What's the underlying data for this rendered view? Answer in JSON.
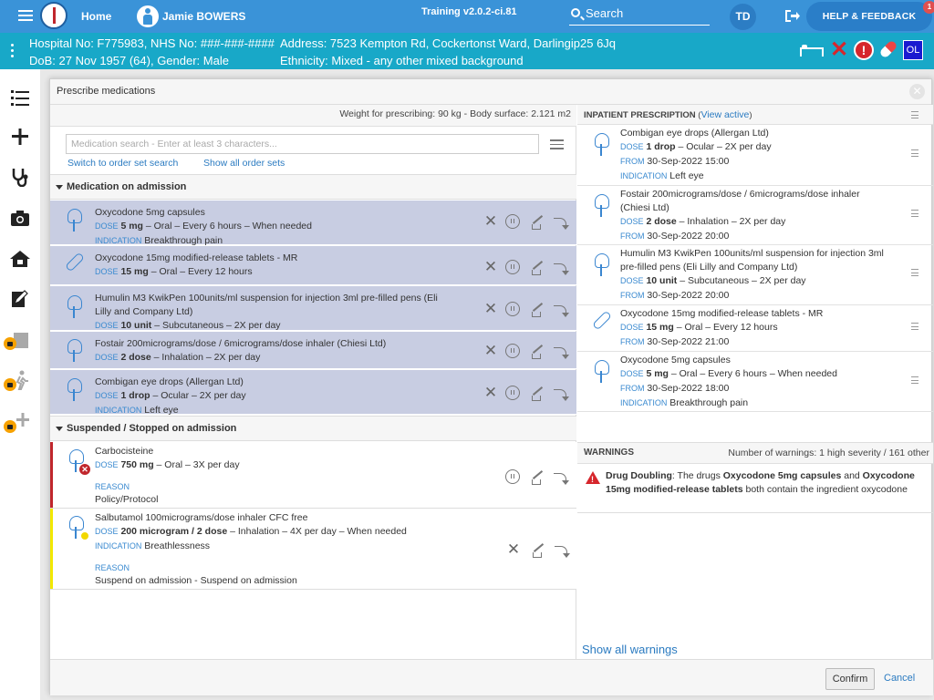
{
  "topbar": {
    "home_label": "Home",
    "patient_name": "Jamie BOWERS",
    "version": "Training v2.0.2-ci.81",
    "search_label": "Search",
    "avatar_initials": "TD",
    "help_label": "HELP & FEEDBACK",
    "help_badge": "1"
  },
  "patient": {
    "line1_left": "Hospital No: F775983, NHS No: ###-###-####",
    "line1_right": "Address: 7523 Kempton Rd, Cockertonst Ward, Darlingip25 6Jq",
    "line2_left": "DoB: 27 Nov 1957 (64), Gender: Male",
    "line2_right": "Ethnicity: Mixed - any other mixed background",
    "ol_label": "OL"
  },
  "modal": {
    "title": "Prescribe medications",
    "weight_line": "Weight for prescribing: 90 kg - Body surface: 2.121 m2",
    "search_placeholder": "Medication search - Enter at least 3 characters...",
    "link_order_set": "Switch to order set search",
    "link_show_all": "Show all order sets",
    "section_admission": "Medication on admission",
    "section_suspended": "Suspended / Stopped on admission",
    "labels": {
      "dose": "DOSE",
      "indication": "INDICATION",
      "reason": "REASON",
      "from": "FROM"
    },
    "admission_meds": [
      {
        "name": "Oxycodone 5mg capsules",
        "dose_bold": "5 mg",
        "dose_rest": " – Oral – Every 6 hours – When needed",
        "indication": "Breakthrough pain"
      },
      {
        "name": "Oxycodone 15mg modified-release tablets - MR",
        "dose_bold": "15 mg",
        "dose_rest": " – Oral – Every 12 hours"
      },
      {
        "name_l1": "Humulin M3 KwikPen 100units/ml suspension for injection 3ml pre-filled pens (Eli",
        "name_l2": "Lilly and Company Ltd)",
        "dose_bold": "10 unit",
        "dose_rest": " – Subcutaneous – 2X per day"
      },
      {
        "name": "Fostair 200micrograms/dose / 6micrograms/dose inhaler (Chiesi Ltd)",
        "dose_bold": "2 dose",
        "dose_rest": " – Inhalation – 2X per day"
      },
      {
        "name": "Combigan eye drops (Allergan Ltd)",
        "dose_bold": "1 drop",
        "dose_rest": " – Ocular – 2X per day",
        "indication": "Left eye"
      }
    ],
    "suspended_meds": [
      {
        "name": "Carbocisteine",
        "dose_bold": "750 mg",
        "dose_rest": " – Oral – 3X per day",
        "reason": "Policy/Protocol"
      },
      {
        "name": "Salbutamol 100micrograms/dose inhaler CFC free",
        "dose_bold": "200 microgram / 2 dose",
        "dose_rest": " – Inhalation – 4X per day – When needed",
        "indication": "Breathlessness",
        "reason": "Suspend on admission - Suspend on admission"
      }
    ],
    "inpatient_title": "INPATIENT PRESCRIPTION",
    "view_active": "View active",
    "inpatient": [
      {
        "name": "Combigan eye drops (Allergan Ltd)",
        "dose_bold": "1 drop",
        "dose_rest": " – Ocular – 2X per day",
        "from": "30-Sep-2022 15:00",
        "indication": "Left eye"
      },
      {
        "name_l1": "Fostair 200micrograms/dose / 6micrograms/dose inhaler",
        "name_l2": "(Chiesi Ltd)",
        "dose_bold": "2 dose",
        "dose_rest": " – Inhalation – 2X per day",
        "from": "30-Sep-2022 20:00"
      },
      {
        "name_l1": "Humulin M3 KwikPen 100units/ml suspension for injection 3ml",
        "name_l2": "pre-filled pens (Eli Lilly and Company Ltd)",
        "dose_bold": "10 unit",
        "dose_rest": " – Subcutaneous – 2X per day",
        "from": "30-Sep-2022 20:00"
      },
      {
        "name": "Oxycodone 15mg modified-release tablets - MR",
        "dose_bold": "15 mg",
        "dose_rest": " – Oral – Every 12 hours",
        "from": "30-Sep-2022 21:00"
      },
      {
        "name": "Oxycodone 5mg capsules",
        "dose_bold": "5 mg",
        "dose_rest": " – Oral – Every 6 hours – When needed",
        "from": "30-Sep-2022 18:00",
        "indication": "Breakthrough pain"
      }
    ],
    "warnings_title": "WARNINGS",
    "warnings_count": "Number of warnings: 1 high severity / 161 other",
    "warning": {
      "t1": "Drug Doubling",
      "t2": ": The drugs ",
      "t3": "Oxycodone 5mg capsules",
      "t4": " and ",
      "t5": "Oxycodone 15mg modified-release tablets",
      "t6": " both contain the ingredient oxycodone"
    },
    "show_all_warnings": "Show all warnings",
    "confirm": "Confirm",
    "cancel": "Cancel"
  }
}
